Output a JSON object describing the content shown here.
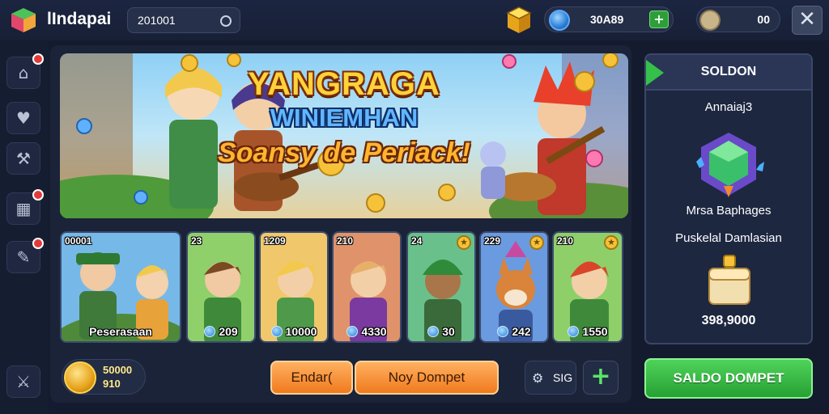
{
  "header": {
    "app_title": "lIndapai",
    "search_value": "201001",
    "gem_value": "30A89",
    "gem_add": "+",
    "chat_value": "00",
    "close": "✕"
  },
  "sidebar": {
    "items": [
      {
        "name": "home",
        "icon": "⌂",
        "badge": true
      },
      {
        "name": "inventory",
        "icon": "♥",
        "badge": false
      },
      {
        "name": "tools",
        "icon": "⚒",
        "badge": false
      },
      {
        "name": "calendar",
        "icon": "▦",
        "badge": true
      },
      {
        "name": "notes",
        "icon": "✎",
        "badge": true
      },
      {
        "name": "battle",
        "icon": "⚔",
        "badge": false
      }
    ]
  },
  "banner": {
    "line1": "YANGRAGA",
    "line2": "WINIEMHAN",
    "line3": "Soansy de Periack!"
  },
  "cards": [
    {
      "tag": "00001",
      "price": "Peserasaan",
      "star": false,
      "coin": false,
      "bg": "#4f8a3a"
    },
    {
      "tag": "23",
      "price": "209",
      "star": false,
      "coin": true,
      "bg": "#66a84a"
    },
    {
      "tag": "1209",
      "price": "10000",
      "star": false,
      "coin": true,
      "bg": "#d8a24a"
    },
    {
      "tag": "210",
      "price": "4330",
      "star": false,
      "coin": true,
      "bg": "#c9744a"
    },
    {
      "tag": "24",
      "price": "30",
      "star": true,
      "coin": true,
      "bg": "#4a8f5a"
    },
    {
      "tag": "229",
      "price": "242",
      "star": true,
      "coin": true,
      "bg": "#4a7fc9"
    },
    {
      "tag": "210",
      "price": "1550",
      "star": true,
      "coin": true,
      "bg": "#5aa048"
    }
  ],
  "footer": {
    "wallet_line1": "50000",
    "wallet_line2": "910",
    "btn1": "Endar(",
    "btn2": "Noy Dompet",
    "sig_text": "SIG",
    "plus": "+"
  },
  "right_panel": {
    "title": "SOLDON",
    "subtitle": "Annaiaj3",
    "line1": "Mrsa Baphages",
    "line2": "Puskelal Damlasian",
    "price": "398,9000"
  },
  "cta": {
    "label": "SALDO DOMPET"
  },
  "colors": {
    "accent_green": "#2fb33f",
    "accent_orange": "#f28a2a",
    "bg": "#141b2e"
  }
}
